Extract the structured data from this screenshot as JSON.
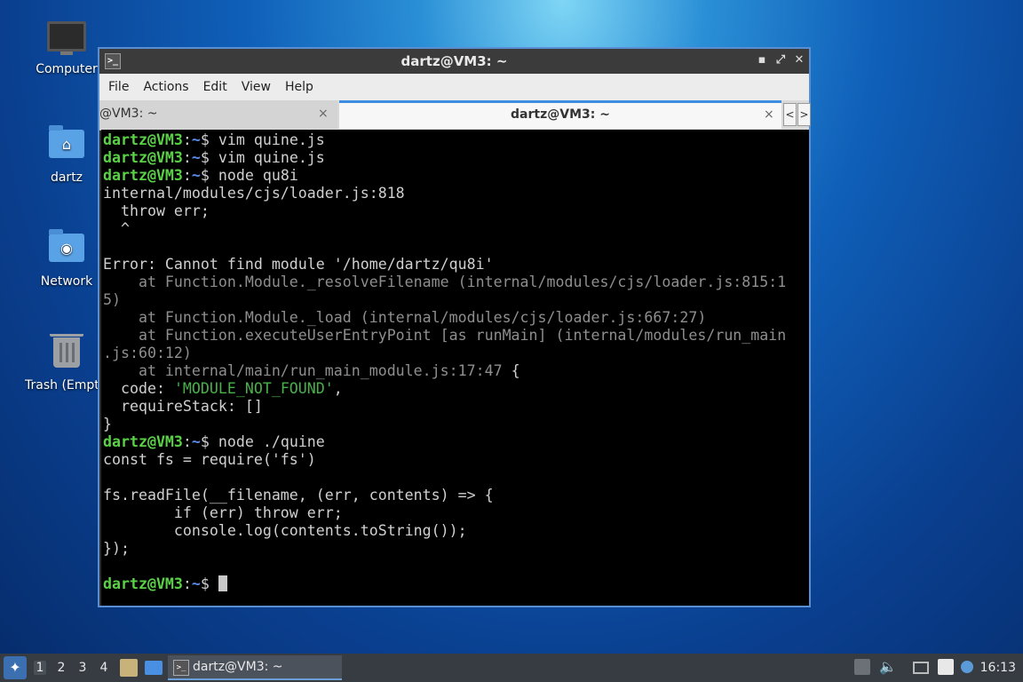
{
  "desktop": {
    "icons": [
      {
        "label": "Computer"
      },
      {
        "label": "dartz"
      },
      {
        "label": "Network"
      },
      {
        "label": "Trash (Empt"
      }
    ]
  },
  "window": {
    "title": "dartz@VM3: ~",
    "menu": [
      "File",
      "Actions",
      "Edit",
      "View",
      "Help"
    ],
    "tabs": [
      {
        "label": "@VM3: ~"
      },
      {
        "label": "dartz@VM3: ~"
      }
    ],
    "close_glyph": "×",
    "tab_prev": "<",
    "tab_next": ">"
  },
  "terminal": {
    "prompt_user": "dartz@VM3",
    "prompt_sep": ":",
    "prompt_path": "~",
    "prompt_end": "$ ",
    "commands": [
      "vim quine.js",
      "vim quine.js",
      "node qu8i",
      "node ./quine"
    ],
    "error_lines": [
      "internal/modules/cjs/loader.js:818",
      "  throw err;",
      "  ^",
      "",
      "Error: Cannot find module '/home/dartz/qu8i'"
    ],
    "stack_lines": [
      "    at Function.Module._resolveFilename (internal/modules/cjs/loader.js:815:1",
      "5)",
      "    at Function.Module._load (internal/modules/cjs/loader.js:667:27)",
      "    at Function.executeUserEntryPoint [as runMain] (internal/modules/run_main",
      ".js:60:12)",
      "    at internal/main/run_main_module.js:17:47"
    ],
    "stack_brace": " {",
    "code_key": "  code: ",
    "code_value": "'MODULE_NOT_FOUND'",
    "code_comma": ",",
    "require_stack": "  requireStack: []",
    "close_brace": "}",
    "output_lines": [
      "const fs = require('fs')",
      "",
      "fs.readFile(__filename, (err, contents) => {",
      "        if (err) throw err;",
      "        console.log(contents.toString());",
      "});",
      ""
    ]
  },
  "panel": {
    "workspaces": [
      "1",
      "2",
      "3",
      "4"
    ],
    "active_workspace": "1",
    "task_label": "dartz@VM3: ~",
    "clock": "16:13"
  }
}
